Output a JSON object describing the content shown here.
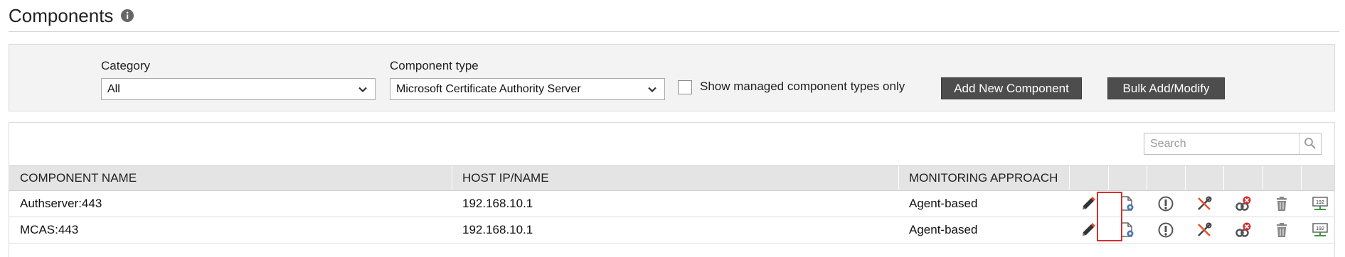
{
  "header": {
    "title": "Components",
    "info_icon": "info-circle-icon"
  },
  "filters": {
    "category_label": "Category",
    "category_value": "All",
    "component_type_label": "Component type",
    "component_type_value": "Microsoft Certificate Authority Server",
    "show_managed_label": "Show managed component types only",
    "show_managed_checked": false,
    "add_new_label": "Add New Component",
    "bulk_label": "Bulk Add/Modify"
  },
  "search": {
    "placeholder": "Search"
  },
  "table": {
    "columns": [
      "COMPONENT NAME",
      "HOST IP/NAME",
      "MONITORING APPROACH"
    ],
    "rows": [
      {
        "name": "Authserver:443",
        "host": "192.168.10.1",
        "approach": "Agent-based"
      },
      {
        "name": "MCAS:443",
        "host": "192.168.10.1",
        "approach": "Agent-based"
      }
    ],
    "action_icons": [
      "edit-pencil-icon",
      "config-document-icon",
      "info-icon",
      "tools-icon",
      "unmanage-icon",
      "delete-trash-icon",
      "ip-monitor-icon"
    ]
  },
  "colors": {
    "button_bg": "#4d4d4d",
    "highlight": "#d32f2f",
    "edit_orange": "#e8502a"
  }
}
